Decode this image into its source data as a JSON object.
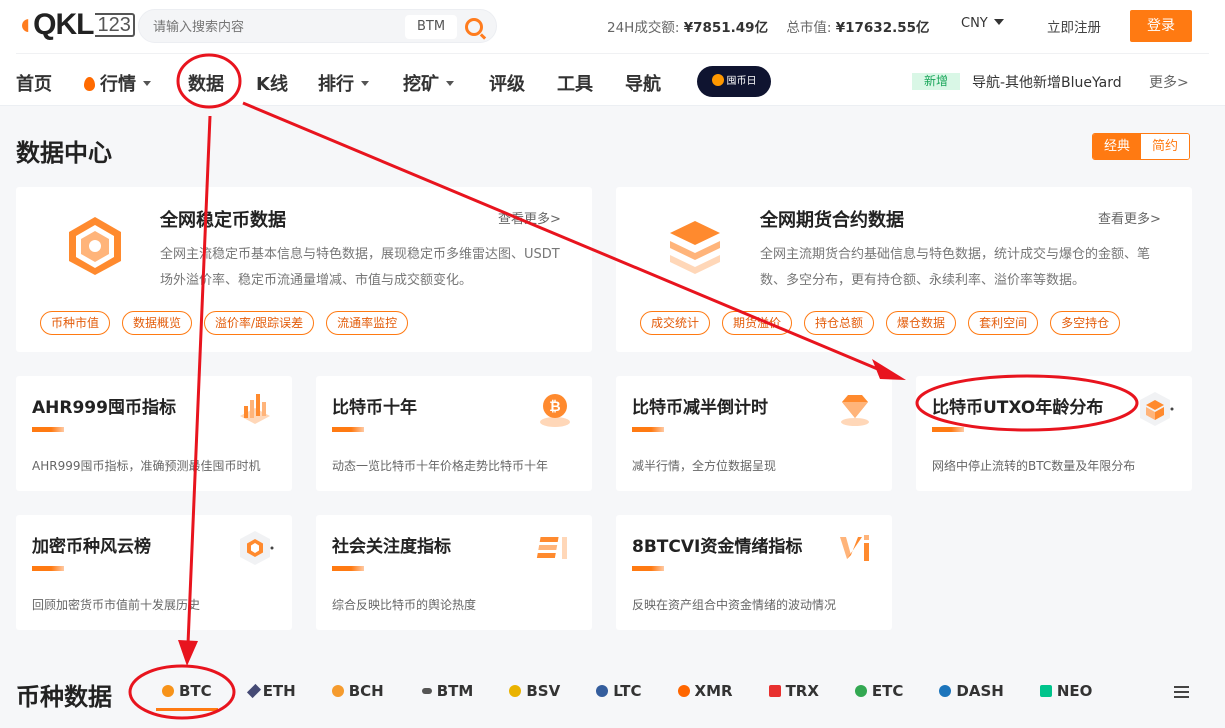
{
  "header": {
    "logo_main": "QKL",
    "logo_num": "123",
    "search_placeholder": "请输入搜索内容",
    "search_tag": "BTM",
    "vol_label": "24H成交额:",
    "vol_value": "¥7851.49亿",
    "mcap_label": "总市值:",
    "mcap_value": "¥17632.55亿",
    "currency": "CNY",
    "register": "立即注册",
    "login": "登录"
  },
  "nav": {
    "items": [
      "首页",
      "行情",
      "数据",
      "K线",
      "排行",
      "挖矿",
      "评级",
      "工具",
      "导航"
    ],
    "banner": "囤币日",
    "new_tag": "新增",
    "news": "导航-其他新增BlueYard",
    "more": "更多>"
  },
  "section": {
    "title": "数据中心",
    "toggle": [
      "经典",
      "简约"
    ]
  },
  "big_cards": [
    {
      "title": "全网稳定币数据",
      "more": "查看更多>",
      "desc": "全网主流稳定币基本信息与特色数据，展现稳定币多维雷达图、USDT场外溢价率、稳定币流通量增减、市值与成交额变化。",
      "chips": [
        "币种市值",
        "数据概览",
        "溢价率/跟踪误差",
        "流通率监控"
      ]
    },
    {
      "title": "全网期货合约数据",
      "more": "查看更多>",
      "desc": "全网主流期货合约基础信息与特色数据，统计成交与爆仓的金额、笔数、多空分布，更有持仓额、永续利率、溢价率等数据。",
      "chips": [
        "成交统计",
        "期货溢价",
        "持仓总额",
        "爆仓数据",
        "套利空间",
        "多空持仓"
      ]
    }
  ],
  "small_cards": [
    {
      "title": "AHR999囤币指标",
      "desc": "AHR999囤币指标，准确预测最佳囤币时机",
      "icon": "bar-chart-icon"
    },
    {
      "title": "比特币十年",
      "desc": "动态一览比特币十年价格走势比特币十年",
      "icon": "bitcoin-icon"
    },
    {
      "title": "比特币减半倒计时",
      "desc": "减半行情，全方位数据呈现",
      "icon": "diamond-icon"
    },
    {
      "title": "比特币UTXO年龄分布",
      "desc": "网络中停止流转的BTC数量及年限分布",
      "icon": "cube-icon"
    },
    {
      "title": "加密币种风云榜",
      "desc": "回顾加密货币市值前十发展历史",
      "icon": "hexagon-icon"
    },
    {
      "title": "社会关注度指标",
      "desc": "综合反映比特币的舆论热度",
      "icon": "stack-icon"
    },
    {
      "title": "8BTCVI资金情绪指标",
      "desc": "反映在资产组合中资金情绪的波动情况",
      "icon": "vi-icon"
    }
  ],
  "coins": {
    "title": "币种数据",
    "tabs": [
      {
        "label": "BTC",
        "color": "#f7931a"
      },
      {
        "label": "ETH",
        "color": "#454a75"
      },
      {
        "label": "BCH",
        "color": "#f59b2e"
      },
      {
        "label": "BTM",
        "color": "#555555"
      },
      {
        "label": "BSV",
        "color": "#eab300"
      },
      {
        "label": "LTC",
        "color": "#345d9d"
      },
      {
        "label": "XMR",
        "color": "#ff6600"
      },
      {
        "label": "TRX",
        "color": "#e8302f"
      },
      {
        "label": "ETC",
        "color": "#33a852"
      },
      {
        "label": "DASH",
        "color": "#1c75bc"
      },
      {
        "label": "NEO",
        "color": "#00c48c"
      }
    ]
  },
  "colors": {
    "accent": "#ff7a12",
    "annotation": "#e8141e"
  }
}
